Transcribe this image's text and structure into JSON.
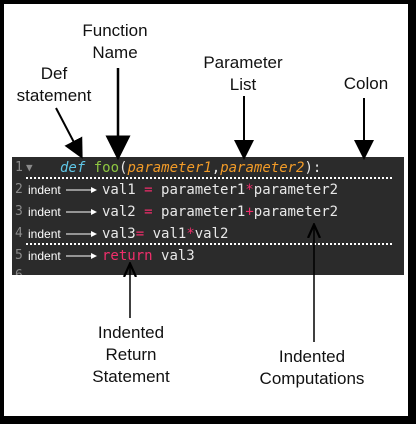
{
  "labels": {
    "function_name": [
      "Function",
      "Name"
    ],
    "def_statement": [
      "Def",
      "statement"
    ],
    "parameter_list": [
      "Parameter",
      "List"
    ],
    "colon": "Colon",
    "indented_return": [
      "Indented",
      "Return",
      "Statement"
    ],
    "indented_computations": [
      "Indented",
      "Computations"
    ]
  },
  "code": {
    "line1": {
      "num": "1",
      "fold": "▼",
      "def": "def",
      "fn": "foo",
      "open": "(",
      "p1": "parameter1",
      "comma": ",",
      "p2": "parameter2",
      "close": "):"
    },
    "line2": {
      "num": "2",
      "tag": "indent",
      "a": "val1",
      "eq": "=",
      "b": "parameter1",
      "op": "*",
      "c": "parameter2"
    },
    "line3": {
      "num": "3",
      "tag": "indent",
      "a": "val2",
      "eq": "=",
      "b": "parameter1",
      "op": "+",
      "c": "parameter2"
    },
    "line4": {
      "num": "4",
      "tag": "indent",
      "a": "val3",
      "eq": "=",
      "b": "val1",
      "op": "*",
      "c": "val2"
    },
    "line5": {
      "num": "5",
      "tag": "indent",
      "kw": "return",
      "a": "val3"
    },
    "line6": {
      "num": "6"
    }
  },
  "colors": {
    "background": "#2b2b2b",
    "def": "#5fc6e6",
    "function": "#8ec641",
    "parameter": "#f19b28",
    "operator": "#f02e6b",
    "frame": "#000000"
  }
}
